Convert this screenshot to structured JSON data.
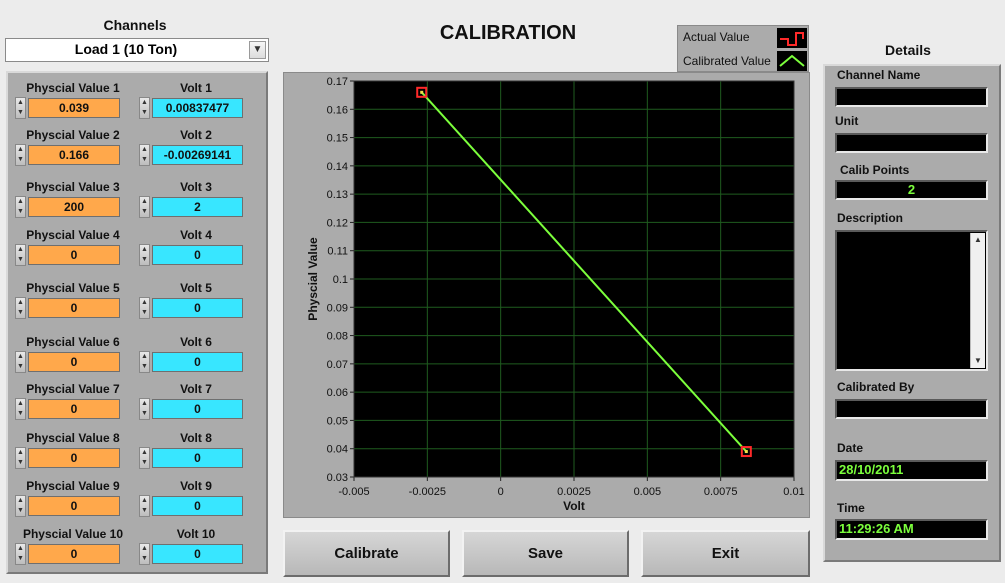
{
  "channels": {
    "label": "Channels",
    "selected": "Load 1 (10 Ton)"
  },
  "main_title": "CALIBRATION",
  "legend": {
    "actual_label": "Actual Value",
    "calibrated_label": "Calibrated Value"
  },
  "calibration_points": [
    {
      "phys_label": "Physcial Value 1",
      "phys_value": "0.039",
      "volt_label": "Volt 1",
      "volt_value": "0.00837477"
    },
    {
      "phys_label": "Physcial Value 2",
      "phys_value": "0.166",
      "volt_label": "Volt 2",
      "volt_value": "-0.00269141"
    },
    {
      "phys_label": "Physcial Value 3",
      "phys_value": "200",
      "volt_label": "Volt 3",
      "volt_value": "2"
    },
    {
      "phys_label": "Physcial Value 4",
      "phys_value": "0",
      "volt_label": "Volt 4",
      "volt_value": "0"
    },
    {
      "phys_label": "Physcial Value 5",
      "phys_value": "0",
      "volt_label": "Volt 5",
      "volt_value": "0"
    },
    {
      "phys_label": "Physcial Value 6",
      "phys_value": "0",
      "volt_label": "Volt 6",
      "volt_value": "0"
    },
    {
      "phys_label": "Physcial Value 7",
      "phys_value": "0",
      "volt_label": "Volt 7",
      "volt_value": "0"
    },
    {
      "phys_label": "Physcial Value 8",
      "phys_value": "0",
      "volt_label": "Volt 8",
      "volt_value": "0"
    },
    {
      "phys_label": "Physcial Value 9",
      "phys_value": "0",
      "volt_label": "Volt 9",
      "volt_value": "0"
    },
    {
      "phys_label": "Physcial Value 10",
      "phys_value": "0",
      "volt_label": "Volt 10",
      "volt_value": "0"
    }
  ],
  "chart_data": {
    "type": "line",
    "xlabel": "Volt",
    "ylabel": "Physcial Value",
    "xlim": [
      -0.005,
      0.01
    ],
    "ylim": [
      0.03,
      0.17
    ],
    "x_ticks": [
      "-0.005",
      "-0.0025",
      "0",
      "0.0025",
      "0.005",
      "0.0075",
      "0.01"
    ],
    "y_ticks": [
      "0.03",
      "0.04",
      "0.05",
      "0.06",
      "0.07",
      "0.08",
      "0.09",
      "0.1",
      "0.11",
      "0.12",
      "0.13",
      "0.14",
      "0.15",
      "0.16",
      "0.17"
    ],
    "grid": true,
    "legend_position": "top-right",
    "series": [
      {
        "name": "Actual Value",
        "color": "#ff2a2a",
        "x": [
          -0.00269141,
          0.00837477
        ],
        "y": [
          0.166,
          0.039
        ]
      },
      {
        "name": "Calibrated Value",
        "color": "#7cff3c",
        "x": [
          -0.00269141,
          0.00837477
        ],
        "y": [
          0.166,
          0.039
        ]
      }
    ]
  },
  "buttons": {
    "calibrate": "Calibrate",
    "save": "Save",
    "exit": "Exit"
  },
  "details": {
    "title": "Details",
    "channel_name_label": "Channel Name",
    "channel_name": "",
    "unit_label": "Unit",
    "unit": "",
    "calib_points_label": "Calib Points",
    "calib_points": "2",
    "description_label": "Description",
    "description": "",
    "calibrated_by_label": "Calibrated By",
    "calibrated_by": "",
    "date_label": "Date",
    "date": "28/10/2011",
    "time_label": "Time",
    "time": "11:29:26 AM"
  },
  "colors": {
    "panel": "#ababab",
    "phys_field": "#ffa84b",
    "volt_field": "#38e6ff",
    "plot_bg": "#000000",
    "grid": "#1f5c1f"
  }
}
